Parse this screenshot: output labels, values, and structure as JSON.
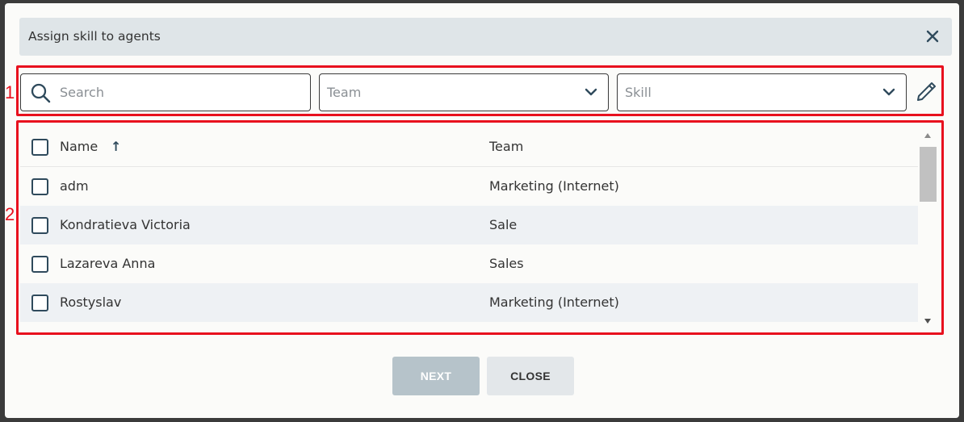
{
  "dialog": {
    "title": "Assign skill to agents",
    "close_icon": "close-icon"
  },
  "annotations": {
    "marker_1": "1",
    "marker_2": "2",
    "outline_color": "#e8101e"
  },
  "filters": {
    "search_placeholder": "Search",
    "team_placeholder": "Team",
    "skill_placeholder": "Skill",
    "edit_icon": "pencil-icon"
  },
  "table": {
    "columns": [
      "Name",
      "Team"
    ],
    "sort_indicator": "↑",
    "rows": [
      {
        "name": "adm",
        "team": "Marketing (Internet)"
      },
      {
        "name": "Kondratieva Victoria",
        "team": "Sale"
      },
      {
        "name": "Lazareva Anna",
        "team": "Sales"
      },
      {
        "name": "Rostyslav",
        "team": "Marketing (Internet)"
      }
    ]
  },
  "footer": {
    "next_label": "NEXT",
    "close_label": "CLOSE"
  }
}
